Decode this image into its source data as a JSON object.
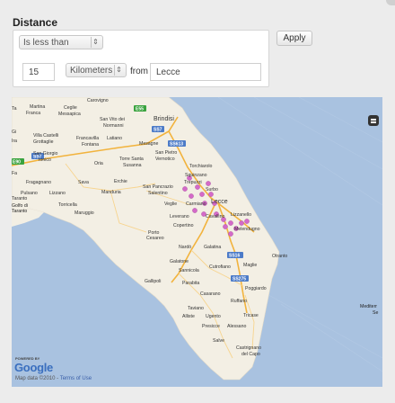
{
  "filter": {
    "title": "Distance",
    "operator_value": "Is less than",
    "distance_value": "15",
    "unit_value": "Kilometers",
    "from_label": "from",
    "place_value": "Lecce",
    "apply_label": "Apply"
  },
  "map": {
    "powered_by": "POWERED BY",
    "logo_text": "Google",
    "credits": "Map data ©2010 -",
    "terms_label": "Terms of Use",
    "places": [
      "Carovigno",
      "Martina",
      "Franca",
      "Ceglie",
      "Messapica",
      "San Vito dei",
      "Normanni",
      "Brindisi",
      "Villa Castelli",
      "Grottaglie",
      "Francavilla",
      "Fontana",
      "Latiano",
      "Mesagne",
      "San Pietro",
      "Vernotico",
      "San Giorgio",
      "Ionico",
      "Oria",
      "Torre Santa",
      "Susanna",
      "Torchiarolo",
      "Squinzano",
      "Fragagnano",
      "Sava",
      "Erchie",
      "San Pancrazio",
      "Salentino",
      "Trepuzzi",
      "Surbo",
      "Pulsano",
      "Lizzano",
      "Manduria",
      "Veglie",
      "Carmiano",
      "Lecce",
      "Golfo di",
      "Taranto",
      "Torricella",
      "Maruggio",
      "Leverano",
      "Cavallino",
      "Lizzanello",
      "Copertino",
      "Melendugno",
      "Porto",
      "Cesareo",
      "Nardò",
      "Galatina",
      "Otranto",
      "Galatone",
      "Sannicola",
      "Cutrofiano",
      "Maglie",
      "Gallipoli",
      "Parabita",
      "Poggiardo",
      "Casarano",
      "Ruffano",
      "Taviano",
      "Tricase",
      "Alliste",
      "Ugento",
      "Presicce",
      "Alessano",
      "Salve",
      "Castrignano",
      "del Capo",
      "Mediterr",
      "Se",
      "Ta",
      "Gi",
      "Ira",
      "Fa",
      "Taranto"
    ],
    "roads": [
      "SS7",
      "E55",
      "SS613",
      "E90",
      "SS7",
      "SS16",
      "SS275"
    ]
  },
  "colors": {
    "pin": "#d46ac8",
    "highway": "#f2b33d",
    "water": "#a9c2e0",
    "land": "#f3efe4"
  }
}
